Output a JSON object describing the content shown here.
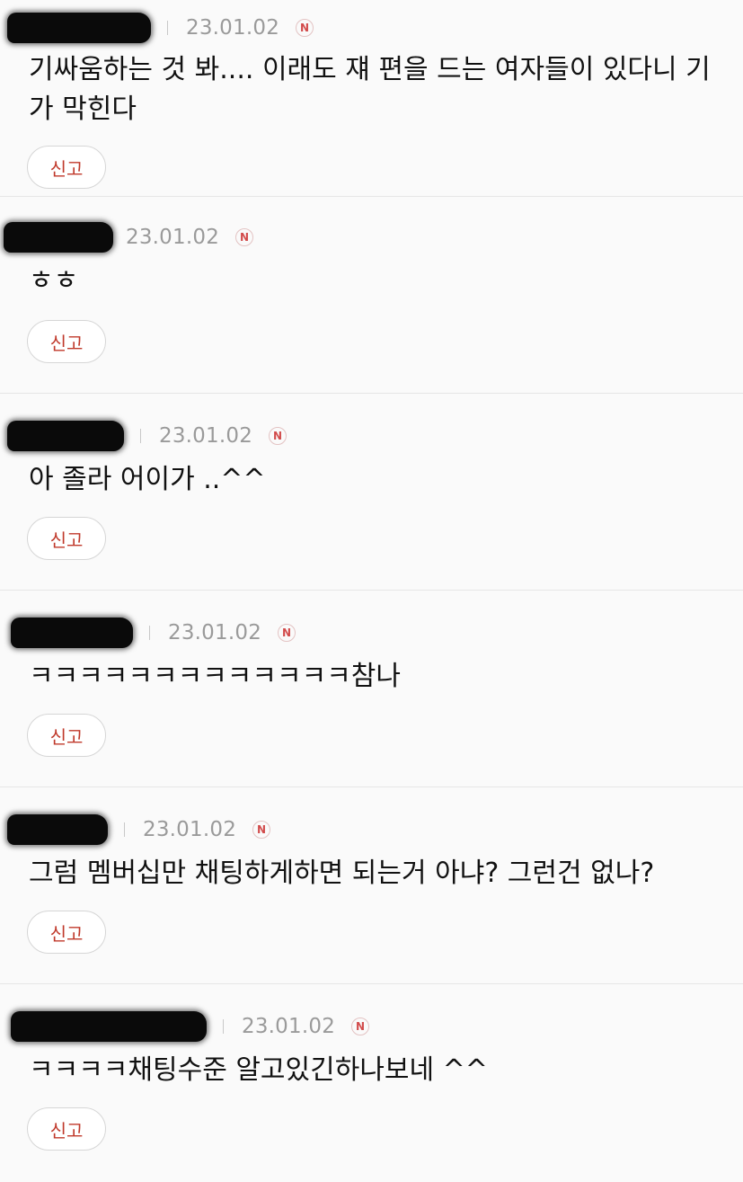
{
  "comments": [
    {
      "date": "23.01.02",
      "badge": "N",
      "text": "기싸움하는 것 봐.... 이래도 쟤 편을 드는 여자들이 있다니 기가 막힌다",
      "report": "신고"
    },
    {
      "date": "23.01.02",
      "badge": "N",
      "text": "ㅎㅎ",
      "report": "신고"
    },
    {
      "date": "23.01.02",
      "badge": "N",
      "text": "아 졸라 어이가 ..^^",
      "report": "신고"
    },
    {
      "date": "23.01.02",
      "badge": "N",
      "text": "ㅋㅋㅋㅋㅋㅋㅋㅋㅋㅋㅋㅋㅋ참나",
      "report": "신고"
    },
    {
      "date": "23.01.02",
      "badge": "N",
      "text": "그럼 멤버십만 채팅하게하면 되는거 아냐? 그런건 없나?",
      "report": "신고"
    },
    {
      "date": "23.01.02",
      "badge": "N",
      "text": "ㅋㅋㅋㅋ채팅수준 알고있긴하나보네 ^^",
      "report": "신고"
    }
  ]
}
